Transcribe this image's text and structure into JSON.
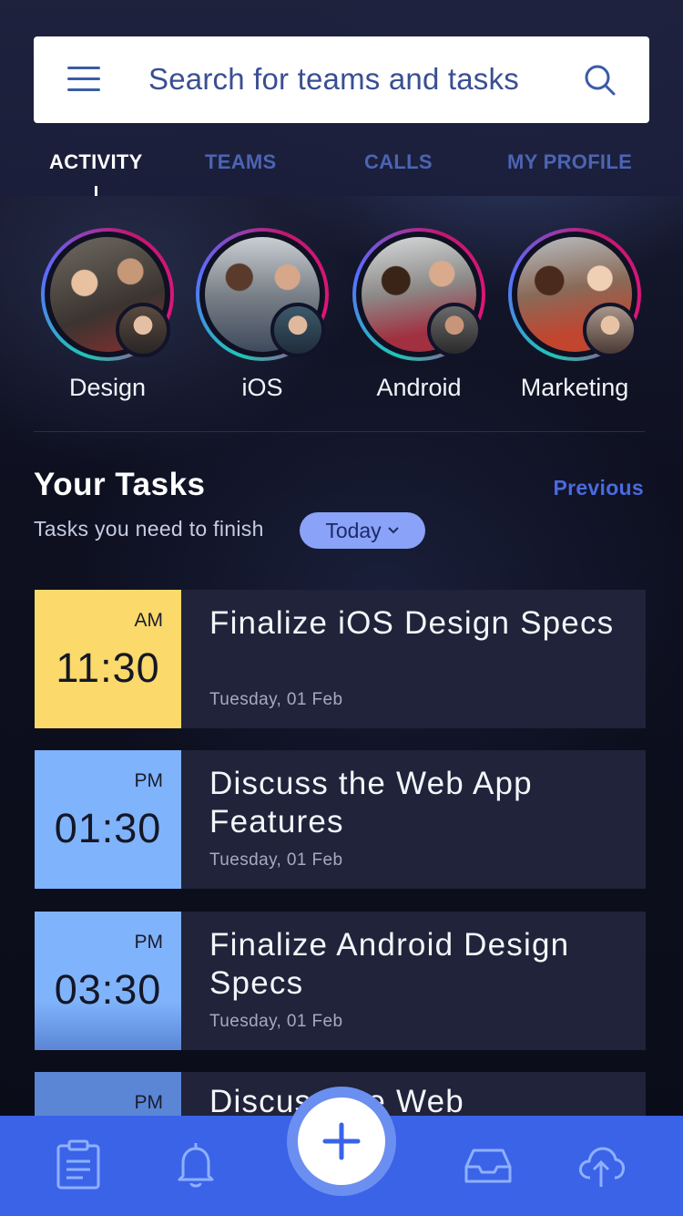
{
  "search": {
    "placeholder": "Search for teams and tasks"
  },
  "tabs": [
    {
      "label": "ACTIVITY",
      "active": true
    },
    {
      "label": "TEAMS",
      "active": false
    },
    {
      "label": "CALLS",
      "active": false
    },
    {
      "label": "MY PROFILE",
      "active": false
    }
  ],
  "teams": [
    {
      "name": "Design"
    },
    {
      "name": "iOS"
    },
    {
      "name": "Android"
    },
    {
      "name": "Marketing"
    }
  ],
  "tasks_section": {
    "title": "Your Tasks",
    "previous_label": "Previous",
    "subtitle": "Tasks you need to finish",
    "filter_label": "Today"
  },
  "tasks": [
    {
      "ampm": "AM",
      "time": "11:30",
      "title": "Finalize iOS Design Specs",
      "date": "Tuesday, 01 Feb",
      "color": "#fbd96a"
    },
    {
      "ampm": "PM",
      "time": "01:30",
      "title": "Discuss the Web App Features",
      "date": "Tuesday, 01 Feb",
      "color": "#7fb3fb"
    },
    {
      "ampm": "PM",
      "time": "03:30",
      "title": "Finalize Android Design Specs",
      "date": "Tuesday, 01 Feb",
      "color": "#7fb3fb"
    },
    {
      "ampm": "PM",
      "time": "",
      "title": "Discuss the Web",
      "date": "",
      "color": "#5b86d6"
    }
  ],
  "colors": {
    "accent": "#3a63e8",
    "pill": "#8aa2f7",
    "link": "#4a6ae0"
  },
  "bottom_nav": {
    "icons": [
      "clipboard-icon",
      "bell-icon",
      "add-icon",
      "inbox-icon",
      "cloud-upload-icon"
    ]
  }
}
